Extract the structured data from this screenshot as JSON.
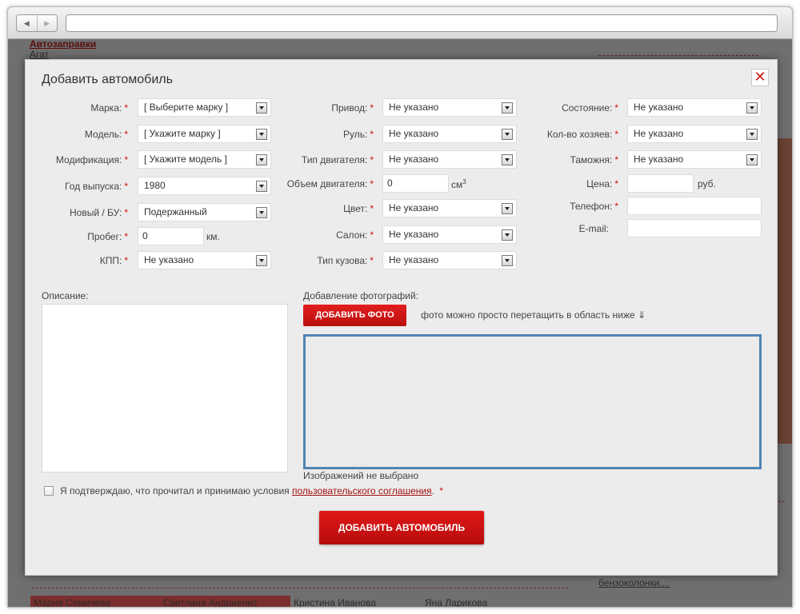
{
  "modal": {
    "title": "Добавить автомобиль",
    "close_symbol": "✕",
    "required_mark": "*"
  },
  "col1": [
    {
      "label": "Марка:",
      "value": "[ Выберите марку ]",
      "type": "select"
    },
    {
      "label": "Модель:",
      "value": "[ Укажите марку ]",
      "type": "select"
    },
    {
      "label": "Модификация:",
      "value": "[ Укажите модель ]",
      "type": "select"
    },
    {
      "label": "Год выпуска:",
      "value": "1980",
      "type": "select"
    },
    {
      "label": "Новый / БУ:",
      "value": "Подержанный",
      "type": "select"
    },
    {
      "label": "Пробег:",
      "value": "0",
      "type": "input",
      "unit": "км."
    },
    {
      "label": "КПП:",
      "value": "Не указано",
      "type": "select"
    }
  ],
  "col2": [
    {
      "label": "Привод:",
      "value": "Не указано",
      "type": "select"
    },
    {
      "label": "Руль:",
      "value": "Не указано",
      "type": "select"
    },
    {
      "label": "Тип двигателя:",
      "value": "Не указано",
      "type": "select"
    },
    {
      "label": "Объем двигателя:",
      "value": "0",
      "type": "input",
      "unit": "см",
      "unit_sup": "3"
    },
    {
      "label": "Цвет:",
      "value": "Не указано",
      "type": "select"
    },
    {
      "label": "Салон:",
      "value": "Не указано",
      "type": "select"
    },
    {
      "label": "Тип кузова:",
      "value": "Не указано",
      "type": "select"
    }
  ],
  "col3": [
    {
      "label": "Состояние:",
      "value": "Не указано",
      "type": "select"
    },
    {
      "label": "Кол-во хозяев:",
      "value": "Не указано",
      "type": "select"
    },
    {
      "label": "Таможня:",
      "value": "Не указано",
      "type": "select"
    },
    {
      "label": "Цена:",
      "value": "",
      "type": "input",
      "unit": "руб."
    },
    {
      "label": "Телефон:",
      "value": "",
      "type": "input"
    },
    {
      "label": "E-mail:",
      "value": "",
      "type": "input"
    }
  ],
  "description": {
    "label": "Описание:"
  },
  "photos": {
    "label": "Добавление фотографий:",
    "add_button": "ДОБАВИТЬ ФОТО",
    "hint": "фото можно просто перетащить в область ниже ⇓",
    "status": "Изображений не выбрано"
  },
  "agreement": {
    "text": "Я подтверждаю, что прочитал и принимаю условия ",
    "link": "пользовательского соглашения",
    "suffix": "."
  },
  "submit_label": "ДОБАВИТЬ АВТОМОБИЛЬ",
  "background": {
    "link1": "Автозаправки",
    "link2": "Агат",
    "people": [
      "Мария Семичева",
      "Светлана Андриенко",
      "Кристина Иванова",
      "Яна Ларикова"
    ],
    "news1": "бензоколонки...."
  }
}
